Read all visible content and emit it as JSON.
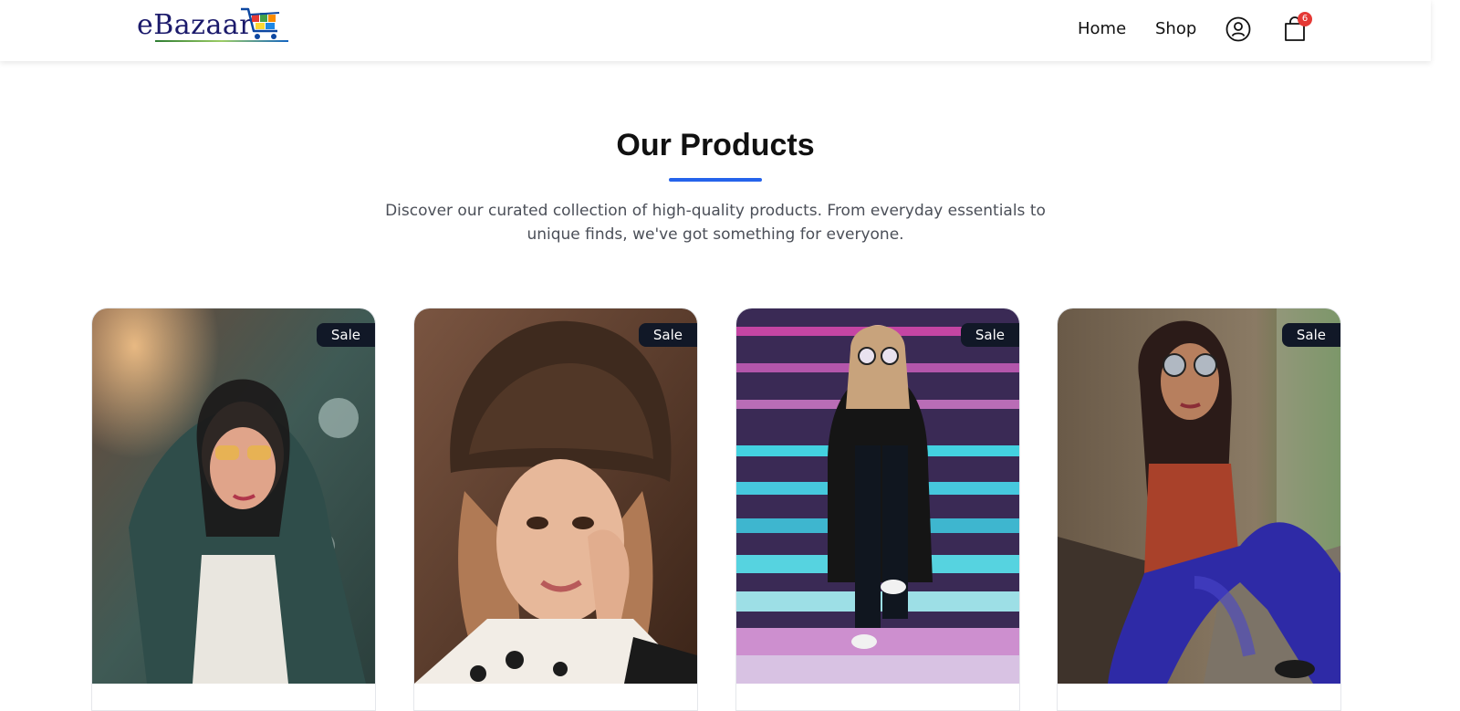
{
  "header": {
    "logo_text": "eBazaar",
    "nav": {
      "home": "Home",
      "shop": "Shop"
    },
    "account_icon": "user-circle-icon",
    "cart_icon": "shopping-bag-icon",
    "cart_count": "6"
  },
  "section": {
    "title": "Our Products",
    "description": "Discover our curated collection of high-quality products. From everyday essentials to unique finds, we've got something for everyone.",
    "accent_color": "#2563eb"
  },
  "products": [
    {
      "badge": "Sale"
    },
    {
      "badge": "Sale"
    },
    {
      "badge": "Sale"
    },
    {
      "badge": "Sale"
    }
  ],
  "colors": {
    "badge_bg": "#111827",
    "cart_badge": "#e53935"
  }
}
